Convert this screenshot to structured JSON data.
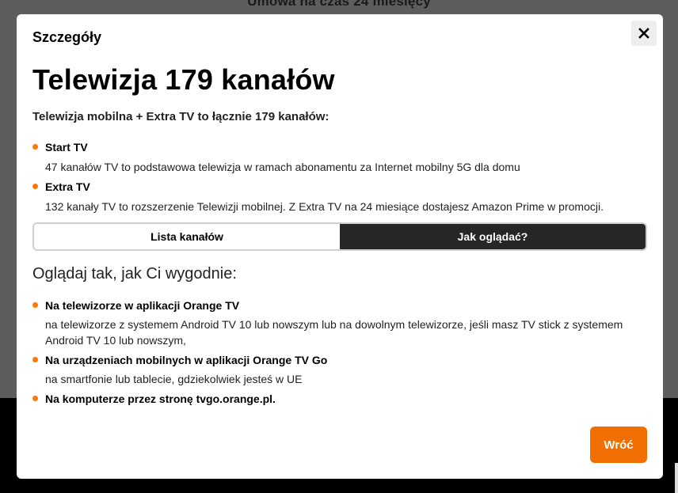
{
  "background": {
    "text": "Umowa na czas 24 miesięcy"
  },
  "modal": {
    "header": "Szczegóły",
    "title": "Telewizja 179 kanałów",
    "subtitle": "Telewizja mobilna + Extra TV to łącznie 179 kanałów:",
    "packages": [
      {
        "title": "Start TV",
        "description": "47 kanałów TV to podstawowa telewizja w ramach abonamentu za Internet mobilny 5G dla domu"
      },
      {
        "title": "Extra TV",
        "description": "132 kanały TV to rozszerzenie Telewizji mobilnej. Z Extra TV na 24 miesiące dostajesz Amazon Prime w promocji."
      }
    ],
    "tabs": [
      {
        "label": "Lista kanałów",
        "active": false
      },
      {
        "label": "Jak oglądać?",
        "active": true
      }
    ],
    "section_heading": "Oglądaj tak, jak Ci wygodnie:",
    "watch_options": [
      {
        "title": "Na telewizorze w aplikacji Orange TV",
        "description": "na telewizorze z systemem Android TV 10 lub nowszym lub na dowolnym telewizorze, jeśli masz TV stick z systemem Android TV 10 lub nowszym,"
      },
      {
        "title": "Na urządzeniach mobilnych w aplikacji Orange TV Go",
        "description": "na smartfonie lub tablecie, gdziekolwiek jesteś w UE"
      },
      {
        "title": "Na komputerze przez stronę tvgo.orange.pl.",
        "description": ""
      }
    ],
    "back_button": "Wróć",
    "close_icon": "close-icon"
  },
  "colors": {
    "accent": "#ff7900",
    "button": "#f16e00",
    "active_tab": "#262626"
  }
}
